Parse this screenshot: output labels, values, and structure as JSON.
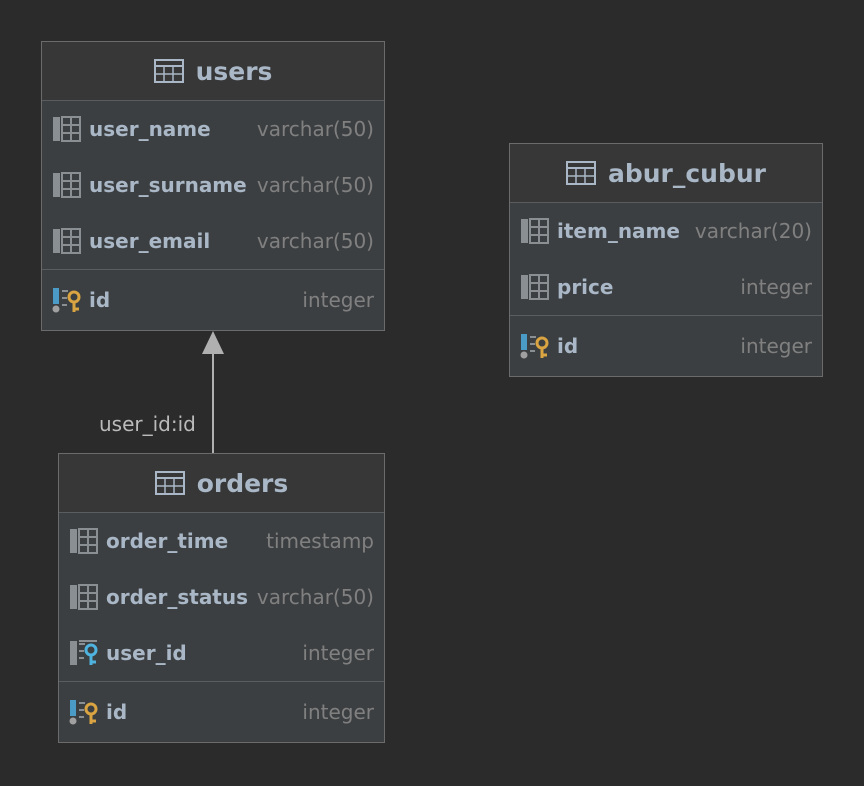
{
  "tables": {
    "users": {
      "name": "users",
      "columns": [
        {
          "name": "user_name",
          "type": "varchar(50)"
        },
        {
          "name": "user_surname",
          "type": "varchar(50)"
        },
        {
          "name": "user_email",
          "type": "varchar(50)"
        }
      ],
      "pk": {
        "name": "id",
        "type": "integer"
      }
    },
    "abur_cubur": {
      "name": "abur_cubur",
      "columns": [
        {
          "name": "item_name",
          "type": "varchar(20)"
        },
        {
          "name": "price",
          "type": "integer"
        }
      ],
      "pk": {
        "name": "id",
        "type": "integer"
      }
    },
    "orders": {
      "name": "orders",
      "columns": [
        {
          "name": "order_time",
          "type": "timestamp"
        },
        {
          "name": "order_status",
          "type": "varchar(50)"
        },
        {
          "name": "user_id",
          "type": "integer",
          "fk": true
        }
      ],
      "pk": {
        "name": "id",
        "type": "integer"
      }
    }
  },
  "relation": {
    "label": "user_id:id",
    "from": "orders",
    "to": "users"
  },
  "colors": {
    "background": "#2b2b2b",
    "entity_fill": "#3c3f41",
    "text": "#a9b7c6",
    "type_text": "#808080",
    "pk_key": "#d9a441",
    "fk_key": "#4fb3e0",
    "arrow": "#b0b0b0"
  },
  "icons": {
    "table": "table-icon",
    "column": "column-icon",
    "primary_key": "primary-key-icon",
    "foreign_key": "foreign-key-icon"
  }
}
